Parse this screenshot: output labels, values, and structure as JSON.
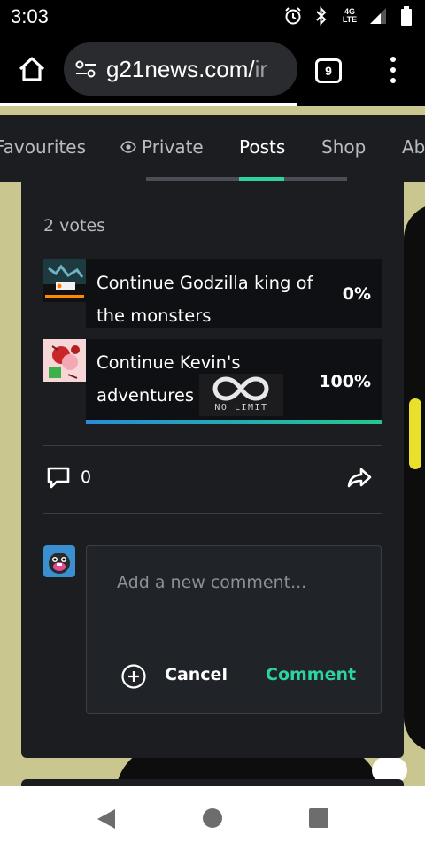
{
  "status_bar": {
    "time": "3:03",
    "network_top": "4G",
    "network_bottom": "LTE",
    "icons": [
      "alarm-icon",
      "bluetooth-icon",
      "signal-icon",
      "battery-icon"
    ]
  },
  "browser": {
    "url_main": "g21news.com/",
    "url_faded": "ir",
    "tab_count": "9"
  },
  "nav_tabs": {
    "items": [
      "Favourites",
      "Private",
      "Posts",
      "Shop",
      "Ab"
    ],
    "active": "Posts"
  },
  "poll": {
    "votes_label": "2 votes",
    "options": [
      {
        "text": "Continue Godzilla king of the monsters",
        "percent_label": "0%",
        "percent": 0
      },
      {
        "text": "Continue Kevin's adventures",
        "percent_label": "100%",
        "percent": 100
      }
    ]
  },
  "watermark": {
    "text": "NO LIMIT"
  },
  "actions": {
    "comment_count": "0"
  },
  "comment_form": {
    "placeholder": "Add a new comment...",
    "cancel_label": "Cancel",
    "submit_label": "Comment"
  },
  "colors": {
    "accent": "#2ed3a2",
    "card_bg": "#1b1d21",
    "page_bg": "#c9c78f"
  }
}
